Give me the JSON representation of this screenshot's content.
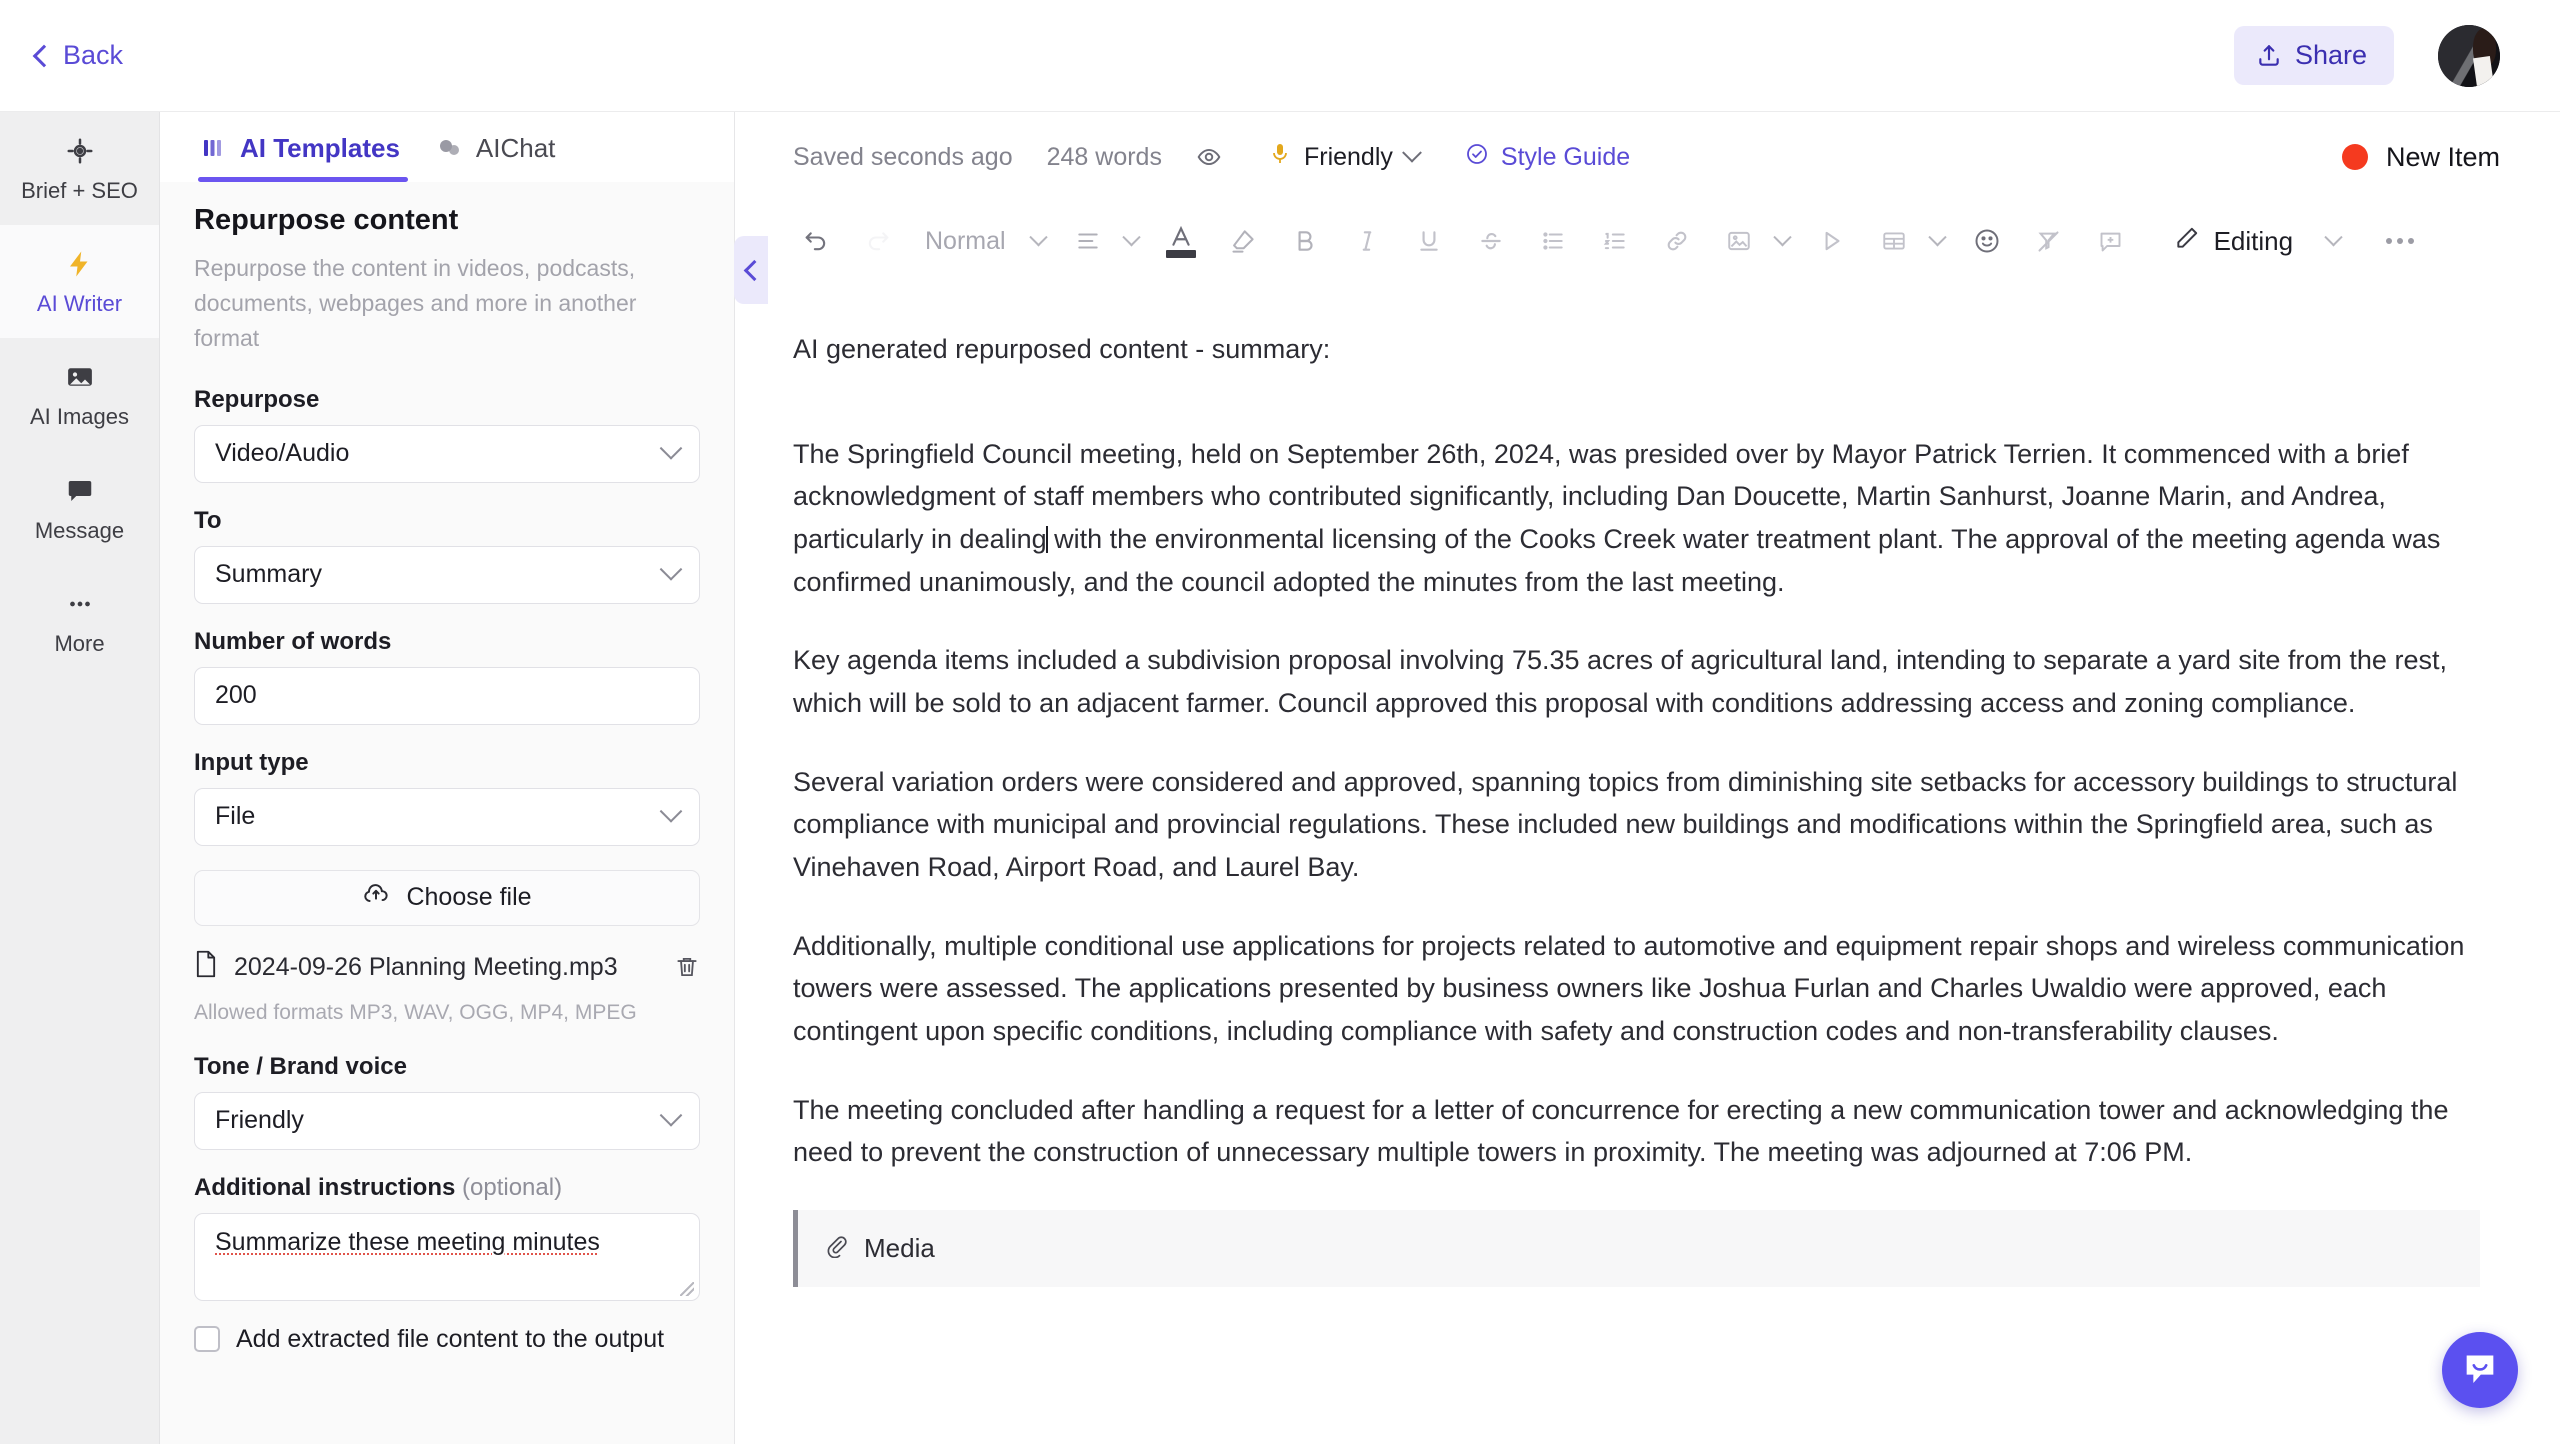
{
  "topbar": {
    "back_label": "Back",
    "share_label": "Share"
  },
  "rail": {
    "items": [
      {
        "label": "Brief + SEO",
        "icon": "target-icon",
        "active": false
      },
      {
        "label": "AI Writer",
        "icon": "lightning-icon",
        "active": true
      },
      {
        "label": "AI Images",
        "icon": "image-icon",
        "active": false
      },
      {
        "label": "Message",
        "icon": "chat-bubble-icon",
        "active": false
      },
      {
        "label": "More",
        "icon": "ellipsis-icon",
        "active": false
      }
    ]
  },
  "panel": {
    "tabs": [
      {
        "label": "AI Templates",
        "icon": "templates-icon",
        "active": true
      },
      {
        "label": "AIChat",
        "icon": "chat-icon",
        "active": false
      }
    ],
    "template_title": "Repurpose content",
    "template_description": "Repurpose the content in videos, podcasts, documents, webpages and more in another format",
    "fields": {
      "repurpose_label": "Repurpose",
      "repurpose_value": "Video/Audio",
      "to_label": "To",
      "to_value": "Summary",
      "words_label": "Number of words",
      "words_value": "200",
      "input_type_label": "Input type",
      "input_type_value": "File",
      "choose_file_label": "Choose file",
      "file_name": "2024-09-26 Planning Meeting.mp3",
      "allowed_formats": "Allowed formats MP3, WAV, OGG, MP4, MPEG",
      "tone_label": "Tone / Brand voice",
      "tone_value": "Friendly",
      "instructions_label": "Additional instructions",
      "instructions_optional": "(optional)",
      "instructions_value": "Summarize these meeting minutes",
      "checkbox_label": "Add extracted file content to the output"
    }
  },
  "editor": {
    "meta": {
      "saved": "Saved seconds ago",
      "word_count": "248 words",
      "tone": "Friendly",
      "style_guide": "Style Guide",
      "new_item": "New Item"
    },
    "toolbar": {
      "style_value": "Normal",
      "mode_label": "Editing"
    },
    "document": {
      "heading": "AI generated repurposed content - summary:",
      "paragraphs": [
        "The Springfield Council meeting, held on September 26th, 2024, was presided over by Mayor Patrick Terrien. It commenced with a brief acknowledgment of staff members who contributed significantly, including Dan Doucette, Martin Sanhurst, Joanne Marin, and Andrea, particularly in dealing with the environmental licensing of the Cooks Creek water treatment plant. The approval of the meeting agenda was confirmed unanimously, and the council adopted the minutes from the last meeting.",
        "Key agenda items included a subdivision proposal involving 75.35 acres of agricultural land, intending to separate a yard site from the rest, which will be sold to an adjacent farmer. Council approved this proposal with conditions addressing access and zoning compliance.",
        "Several variation orders were considered and approved, spanning topics from diminishing site setbacks for accessory buildings to structural compliance with municipal and provincial regulations. These included new buildings and modifications within the Springfield area, such as Vinehaven Road, Airport Road, and Laurel Bay.",
        "Additionally, multiple conditional use applications for projects related to automotive and equipment repair shops and wireless communication towers were assessed. The applications presented by business owners like Joshua Furlan and Charles Uwaldio were approved, each contingent upon specific conditions, including compliance with safety and construction codes and non-transferability clauses.",
        "The meeting concluded after handling a request for a letter of concurrence for erecting a new communication tower and acknowledging the need to prevent the construction of unnecessary multiple towers in proximity. The meeting was adjourned at 7:06 PM."
      ],
      "media_label": "Media"
    }
  },
  "colors": {
    "accent_purple": "#5a4bd6",
    "share_bg": "#ebe9fb",
    "new_item_dot": "#f53a1f",
    "chat_fab": "#5b50f0"
  }
}
